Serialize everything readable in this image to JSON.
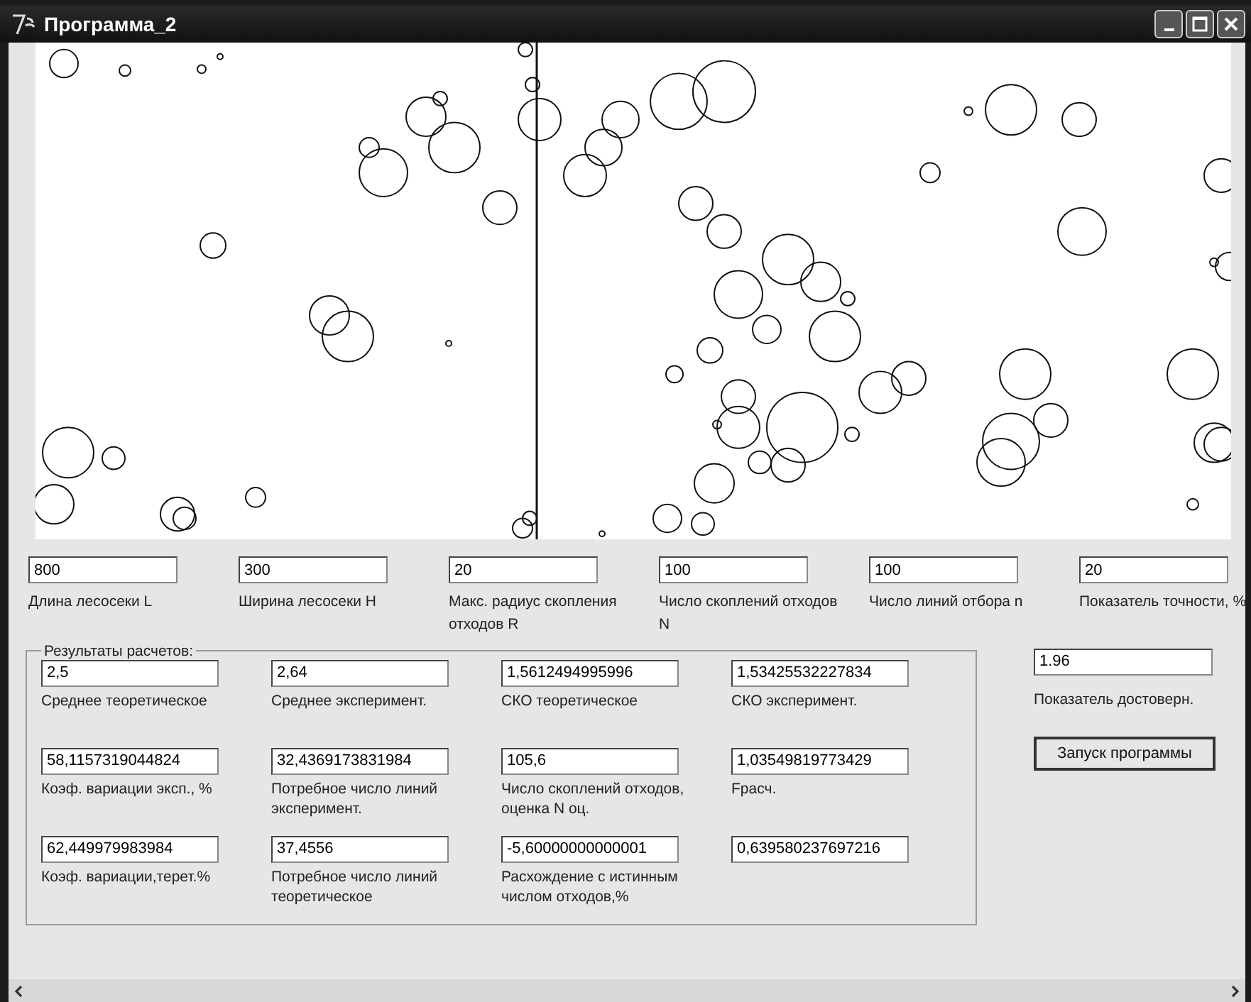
{
  "window": {
    "title": "Программа_2"
  },
  "parameters": [
    {
      "value": "800",
      "label": "Длина лесосеки L"
    },
    {
      "value": "300",
      "label": "Ширина лесосеки H"
    },
    {
      "value": "20",
      "label": "Макс. радиус скопления отходов R"
    },
    {
      "value": "100",
      "label": "Число скоплений отходов N"
    },
    {
      "value": "100",
      "label": "Число линий отбора n"
    },
    {
      "value": "20",
      "label": "Показатель точности, %"
    }
  ],
  "results": {
    "title": "Результаты расчетов:",
    "fields": [
      {
        "value": "2,5",
        "label": "Среднее теоретическое"
      },
      {
        "value": "2,64",
        "label": "Среднее эксперимент."
      },
      {
        "value": "1,5612494995996",
        "label": "СКО теоретическое"
      },
      {
        "value": "1,53425532227834",
        "label": "СКО эксперимент."
      },
      {
        "value": "58,1157319044824",
        "label": "Коэф. вариации эксп., %"
      },
      {
        "value": "32,4369173831984",
        "label": "Потребное число линий эксперимент."
      },
      {
        "value": "105,6",
        "label": "Число скоплений отходов, оценка N оц."
      },
      {
        "value": "1,03549819773429",
        "label": "Fрасч."
      },
      {
        "value": "62,449979983984",
        "label": "Коэф. вариации,терет.%"
      },
      {
        "value": "37,4556",
        "label": "Потребное число линий теоретическое"
      },
      {
        "value": "-5,60000000000001",
        "label": "Расхождение с истинным числом отходов,%"
      },
      {
        "value": "0,639580237697216"
      }
    ]
  },
  "reliability": {
    "value": "1.96",
    "label": "Показатель достоверн."
  },
  "run_button": "Запуск программы"
}
